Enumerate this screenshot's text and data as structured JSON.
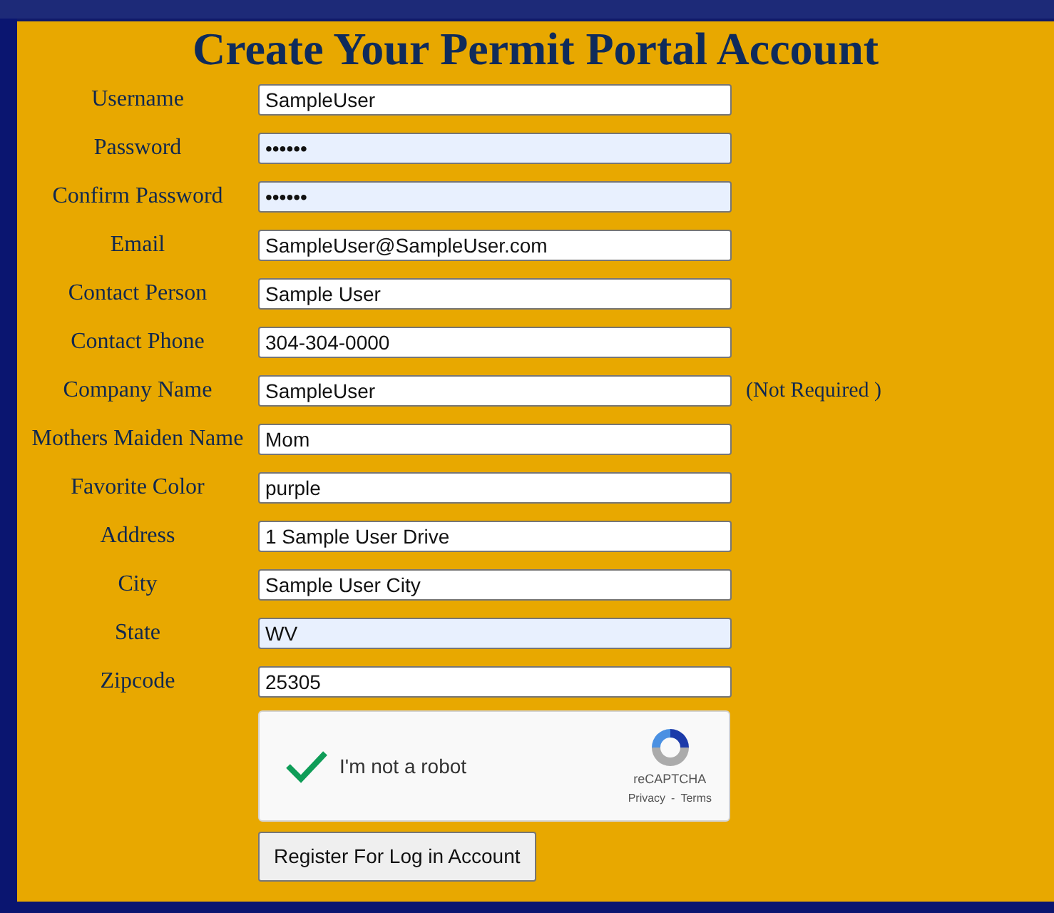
{
  "title": "Create Your Permit Portal Account",
  "fields": [
    {
      "label": "Username",
      "value": "SampleUser",
      "autofilled": false
    },
    {
      "label": "Password",
      "value": "••••••",
      "autofilled": true
    },
    {
      "label": "Confirm Password",
      "value": "••••••",
      "autofilled": true
    },
    {
      "label": "Email",
      "value": "SampleUser@SampleUser.com",
      "autofilled": false
    },
    {
      "label": "Contact Person",
      "value": "Sample User",
      "autofilled": false
    },
    {
      "label": "Contact Phone",
      "value": "304-304-0000",
      "autofilled": false
    },
    {
      "label": "Company Name",
      "value": "SampleUser",
      "autofilled": false,
      "note": "(Not Required )"
    },
    {
      "label": "Mothers Maiden Name",
      "value": "Mom",
      "autofilled": false
    },
    {
      "label": "Favorite Color",
      "value": "purple",
      "autofilled": false
    },
    {
      "label": "Address",
      "value": "1 Sample User Drive",
      "autofilled": false
    },
    {
      "label": "City",
      "value": "Sample User City",
      "autofilled": false
    },
    {
      "label": "State",
      "value": "WV",
      "autofilled": true
    },
    {
      "label": "Zipcode",
      "value": "25305",
      "autofilled": false
    }
  ],
  "captcha": {
    "checked": true,
    "label": "I'm not a robot",
    "brand": "reCAPTCHA",
    "privacy": "Privacy",
    "separator": "-",
    "terms": "Terms"
  },
  "submit_button": "Register For Log in Account"
}
